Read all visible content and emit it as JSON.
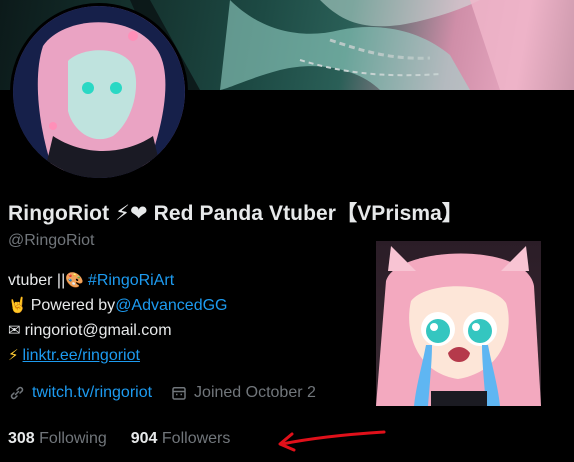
{
  "profile": {
    "display_name": "RingoRiot ⚡❤ Red Panda Vtuber【VPrisma】",
    "handle": "@RingoRiot"
  },
  "bio": {
    "line1_text": "vtuber  ||  ",
    "line1_emoji": "🎨",
    "line1_tag": "#RingoRiArt",
    "line2_emoji": "🤘",
    "line2_text": "Powered by ",
    "line2_mention": "@AdvancedGG",
    "line3_emoji": "✉",
    "line3_text": "ringoriot@gmail.com",
    "line4_emoji": "⚡",
    "line4_link": "linktr.ee/ringoriot"
  },
  "meta": {
    "website": "twitch.tv/ringoriot",
    "joined": "Joined October 2"
  },
  "stats": {
    "following_count": "308",
    "following_label": "Following",
    "followers_count": "904",
    "followers_label": "Followers"
  },
  "icons": [
    "link-icon",
    "calendar-icon"
  ],
  "colors": {
    "accent": "#1d9bf0",
    "muted": "#71767b",
    "text": "#e7e9ea",
    "annotation": "#e0101a"
  }
}
